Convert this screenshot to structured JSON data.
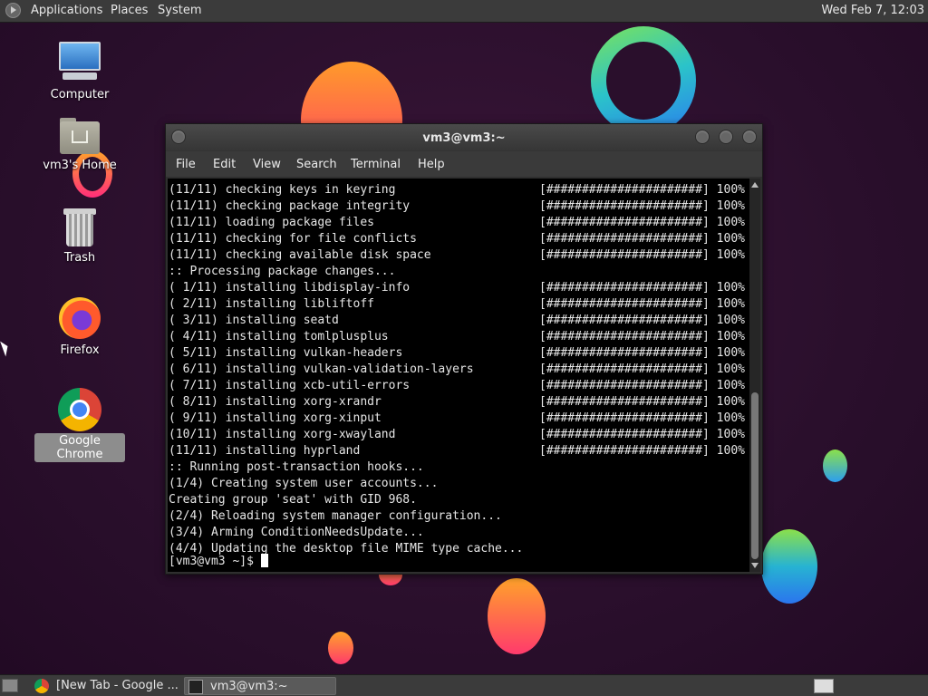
{
  "top_panel": {
    "menus": [
      "Applications",
      "Places",
      "System"
    ],
    "clock": "Wed Feb  7, 12:03"
  },
  "desktop_icons": [
    {
      "label": "Computer",
      "icon": "computer-icon"
    },
    {
      "label": "vm3's Home",
      "icon": "home-folder-icon"
    },
    {
      "label": "Trash",
      "icon": "trash-icon"
    },
    {
      "label": "Firefox",
      "icon": "firefox-icon"
    },
    {
      "label": "Google Chrome",
      "icon": "chrome-icon",
      "selected": true
    }
  ],
  "terminal": {
    "title": "vm3@vm3:~",
    "menus": [
      "File",
      "Edit",
      "View",
      "Search",
      "Terminal",
      "Help"
    ],
    "lines": [
      {
        "text": "(11/11) checking keys in keyring",
        "bar": "[######################] 100%"
      },
      {
        "text": "(11/11) checking package integrity",
        "bar": "[######################] 100%"
      },
      {
        "text": "(11/11) loading package files",
        "bar": "[######################] 100%"
      },
      {
        "text": "(11/11) checking for file conflicts",
        "bar": "[######################] 100%"
      },
      {
        "text": "(11/11) checking available disk space",
        "bar": "[######################] 100%"
      },
      {
        "text": ":: Processing package changes...",
        "bar": ""
      },
      {
        "text": "( 1/11) installing libdisplay-info",
        "bar": "[######################] 100%"
      },
      {
        "text": "( 2/11) installing libliftoff",
        "bar": "[######################] 100%"
      },
      {
        "text": "( 3/11) installing seatd",
        "bar": "[######################] 100%"
      },
      {
        "text": "( 4/11) installing tomlplusplus",
        "bar": "[######################] 100%"
      },
      {
        "text": "( 5/11) installing vulkan-headers",
        "bar": "[######################] 100%"
      },
      {
        "text": "( 6/11) installing vulkan-validation-layers",
        "bar": "[######################] 100%"
      },
      {
        "text": "( 7/11) installing xcb-util-errors",
        "bar": "[######################] 100%"
      },
      {
        "text": "( 8/11) installing xorg-xrandr",
        "bar": "[######################] 100%"
      },
      {
        "text": "( 9/11) installing xorg-xinput",
        "bar": "[######################] 100%"
      },
      {
        "text": "(10/11) installing xorg-xwayland",
        "bar": "[######################] 100%"
      },
      {
        "text": "(11/11) installing hyprland",
        "bar": "[######################] 100%"
      },
      {
        "text": ":: Running post-transaction hooks...",
        "bar": ""
      },
      {
        "text": "(1/4) Creating system user accounts...",
        "bar": ""
      },
      {
        "text": "Creating group 'seat' with GID 968.",
        "bar": ""
      },
      {
        "text": "(2/4) Reloading system manager configuration...",
        "bar": ""
      },
      {
        "text": "(3/4) Arming ConditionNeedsUpdate...",
        "bar": ""
      },
      {
        "text": "(4/4) Updating the desktop file MIME type cache...",
        "bar": ""
      }
    ],
    "prompt": "[vm3@vm3 ~]$ "
  },
  "taskbar": {
    "tasks": [
      {
        "label": "[New Tab - Google ...",
        "icon": "chrome-icon"
      },
      {
        "label": "vm3@vm3:~",
        "icon": "terminal-icon",
        "active": true
      }
    ]
  }
}
